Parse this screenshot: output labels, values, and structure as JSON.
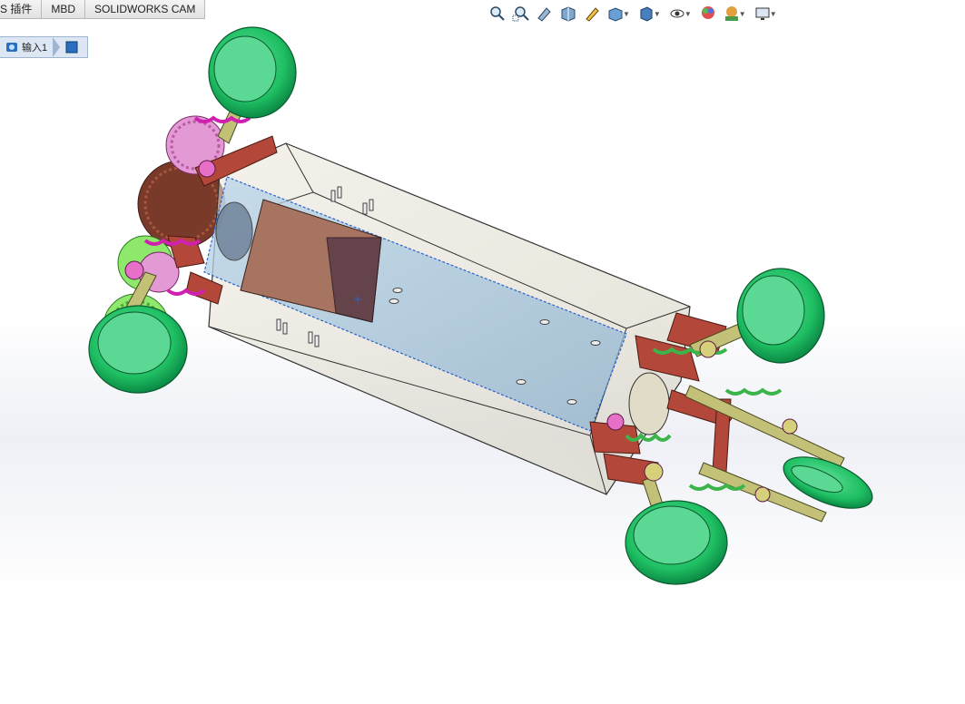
{
  "tabs": [
    {
      "label": "S 插件"
    },
    {
      "label": "MBD"
    },
    {
      "label": "SOLIDWORKS CAM"
    }
  ],
  "breadcrumb": {
    "part_label": "输入1"
  },
  "hud_icons": [
    "zoom-to-fit-icon",
    "zoom-area-icon",
    "previous-view-icon",
    "section-view-icon",
    "dynamic-annotation-icon",
    "view-orientation-icon",
    "display-style-icon",
    "hide-show-items-icon",
    "edit-appearance-icon",
    "apply-scene-icon",
    "view-settings-icon"
  ],
  "colors": {
    "wheel": "#22c46a",
    "wheel_hub": "#4ed48a",
    "gear_green": "#7ed957",
    "gear_pink": "#e08ad0",
    "spring_magenta": "#d020b0",
    "spring_green": "#3bb54a",
    "chassis_red": "#b3473a",
    "housing": "#d8d3c2",
    "motor": "#a87462",
    "panel_blue": "#9fc3de"
  }
}
